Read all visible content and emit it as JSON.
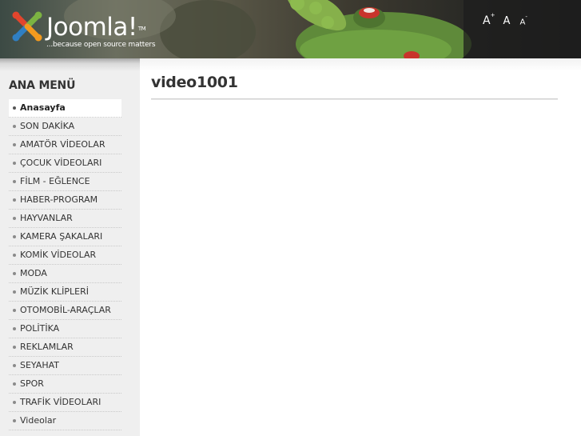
{
  "header": {
    "logo_word": "Joomla!",
    "logo_tm": "TM",
    "tagline": "...because open source matters",
    "font_controls": {
      "increase": "A",
      "increase_sup": "+",
      "reset": "A",
      "decrease": "A",
      "decrease_sup": "-"
    }
  },
  "sidebar": {
    "title": "ANA MENÜ",
    "items": [
      {
        "label": "Anasayfa",
        "active": true
      },
      {
        "label": "SON DAKİKA"
      },
      {
        "label": "AMATÖR VİDEOLAR"
      },
      {
        "label": "ÇOCUK VİDEOLARI"
      },
      {
        "label": "FİLM - EĞLENCE"
      },
      {
        "label": "HABER-PROGRAM"
      },
      {
        "label": "HAYVANLAR"
      },
      {
        "label": "KAMERA ŞAKALARI"
      },
      {
        "label": "KOMİK VİDEOLAR"
      },
      {
        "label": "MODA"
      },
      {
        "label": "MÜZİK KLİPLERİ"
      },
      {
        "label": "OTOMOBİL-ARAÇLAR"
      },
      {
        "label": "POLİTİKA"
      },
      {
        "label": "REKLAMLAR"
      },
      {
        "label": "SEYAHAT"
      },
      {
        "label": "SPOR"
      },
      {
        "label": "TRAFİK VİDEOLARI"
      },
      {
        "label": "Videolar"
      }
    ]
  },
  "main": {
    "title": "video1001"
  },
  "colors": {
    "text": "#333333",
    "sidebar_bg": "#efefef",
    "frog_green": "#5f8a3a",
    "frog_red": "#c8342c",
    "logo_red": "#e2452d",
    "logo_blue": "#2f7fc3",
    "logo_green": "#7cb342",
    "logo_orange": "#f39a1e"
  }
}
